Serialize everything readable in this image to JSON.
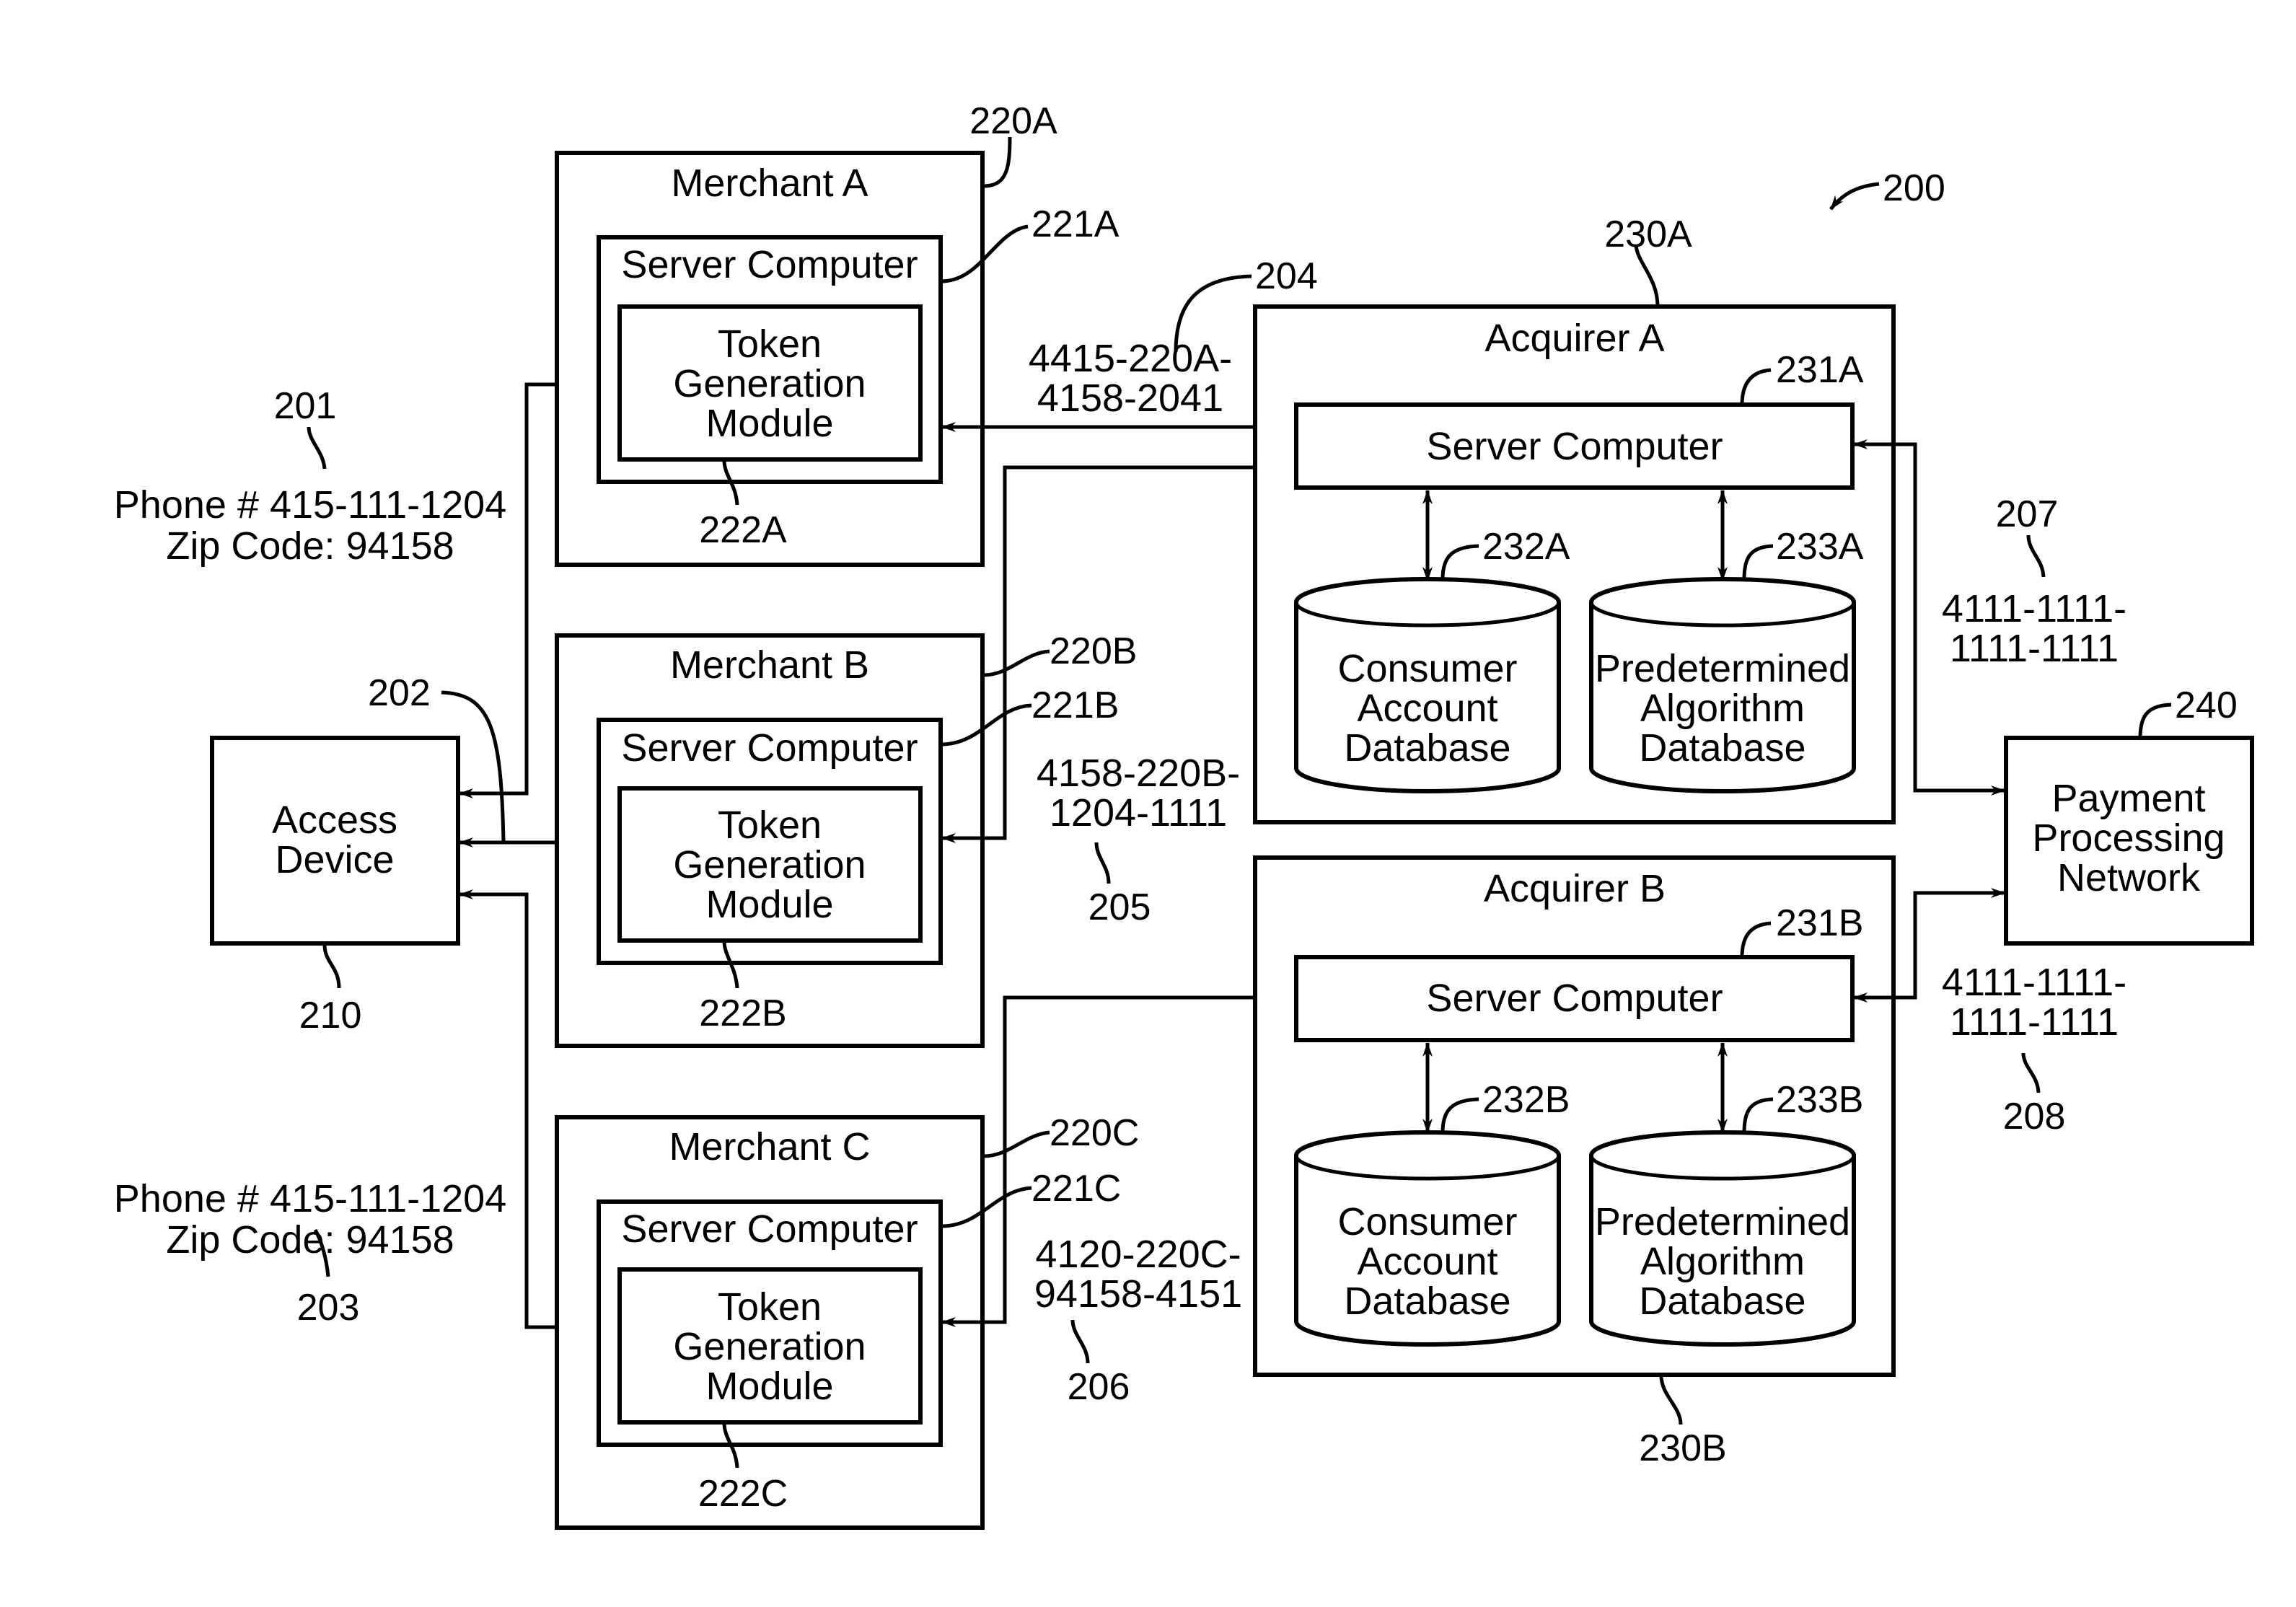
{
  "figure_ref": "200",
  "access_device": {
    "label_lines": [
      "Access",
      "Device"
    ],
    "ref": "210"
  },
  "customer_info_1": {
    "ref": "201",
    "lines": [
      "Phone # 415-111-1204",
      "Zip Code: 94158"
    ]
  },
  "customer_info_2": {
    "ref": "203",
    "lines": [
      "Phone # 415-111-1204",
      "Zip Code: 94158"
    ]
  },
  "access_link_ref": "202",
  "merchants": [
    {
      "title": "Merchant A",
      "ref": "220A",
      "server_label": "Server Computer",
      "server_ref": "221A",
      "module_lines": [
        "Token",
        "Generation",
        "Module"
      ],
      "module_ref": "222A"
    },
    {
      "title": "Merchant B",
      "ref": "220B",
      "server_label": "Server Computer",
      "server_ref": "221B",
      "module_lines": [
        "Token",
        "Generation",
        "Module"
      ],
      "module_ref": "222B"
    },
    {
      "title": "Merchant C",
      "ref": "220C",
      "server_label": "Server Computer",
      "server_ref": "221C",
      "module_lines": [
        "Token",
        "Generation",
        "Module"
      ],
      "module_ref": "222C"
    }
  ],
  "tokens": [
    {
      "ref": "204",
      "lines": [
        "4415-220A-",
        "4158-2041"
      ]
    },
    {
      "ref": "205",
      "lines": [
        "4158-220B-",
        "1204-1111"
      ]
    },
    {
      "ref": "206",
      "lines": [
        "4120-220C-",
        "94158-4151"
      ]
    }
  ],
  "acquirers": [
    {
      "title": "Acquirer A",
      "ref": "230A",
      "server_label": "Server Computer",
      "server_ref": "231A",
      "db1_lines": [
        "Consumer",
        "Account",
        "Database"
      ],
      "db1_ref": "232A",
      "db2_lines": [
        "Predetermined",
        "Algorithm",
        "Database"
      ],
      "db2_ref": "233A"
    },
    {
      "title": "Acquirer B",
      "ref": "230B",
      "server_label": "Server Computer",
      "server_ref": "231B",
      "db1_lines": [
        "Consumer",
        "Account",
        "Database"
      ],
      "db1_ref": "232B",
      "db2_lines": [
        "Predetermined",
        "Algorithm",
        "Database"
      ],
      "db2_ref": "233B"
    }
  ],
  "payment_network": {
    "label_lines": [
      "Payment",
      "Processing",
      "Network"
    ],
    "ref": "240"
  },
  "account_numbers": [
    {
      "ref": "207",
      "lines": [
        "4111-1111-",
        "1111-1111"
      ]
    },
    {
      "ref": "208",
      "lines": [
        "4111-1111-",
        "1111-1111"
      ]
    }
  ]
}
